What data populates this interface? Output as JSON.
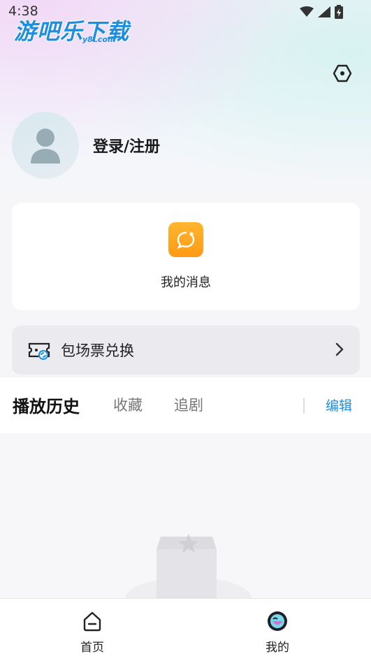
{
  "status_bar": {
    "time": "4:38"
  },
  "watermark": {
    "main": "游吧乐下载",
    "sub": "y8Lcom"
  },
  "profile": {
    "login_label": "登录/注册"
  },
  "messages_card": {
    "label": "我的消息"
  },
  "ticket_card": {
    "label": "包场票兑换"
  },
  "tabs": [
    {
      "label": "播放历史",
      "active": true
    },
    {
      "label": "收藏",
      "active": false
    },
    {
      "label": "追剧",
      "active": false
    }
  ],
  "edit_label": "编辑",
  "bottom_nav": [
    {
      "label": "首页"
    },
    {
      "label": "我的"
    }
  ],
  "colors": {
    "accent": "#1b8ee6",
    "message_icon": "#ffa11f"
  }
}
